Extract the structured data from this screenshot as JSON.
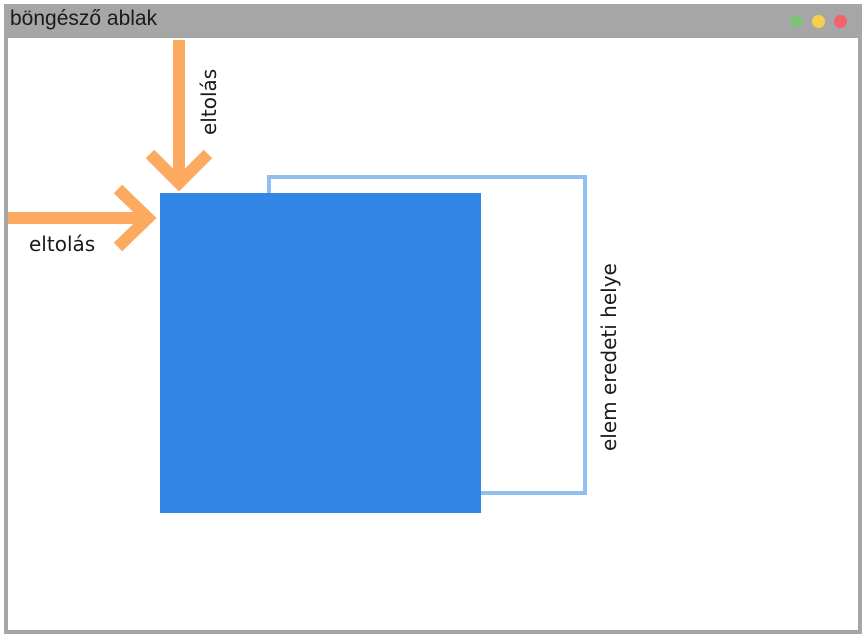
{
  "window": {
    "title": "böngésző ablak",
    "controls": [
      {
        "name": "green",
        "color": "#7ec27a"
      },
      {
        "name": "yellow",
        "color": "#f5d04a"
      },
      {
        "name": "red",
        "color": "#f0636a"
      }
    ]
  },
  "diagram": {
    "arrow_top_label": "eltolás",
    "arrow_left_label": "eltolás",
    "original_position_label": "elem eredeti helye",
    "colors": {
      "arrow": "#fbaa60",
      "element": "#3385e6",
      "original_outline": "#91bff2",
      "frame": "#a6a6a6"
    }
  }
}
